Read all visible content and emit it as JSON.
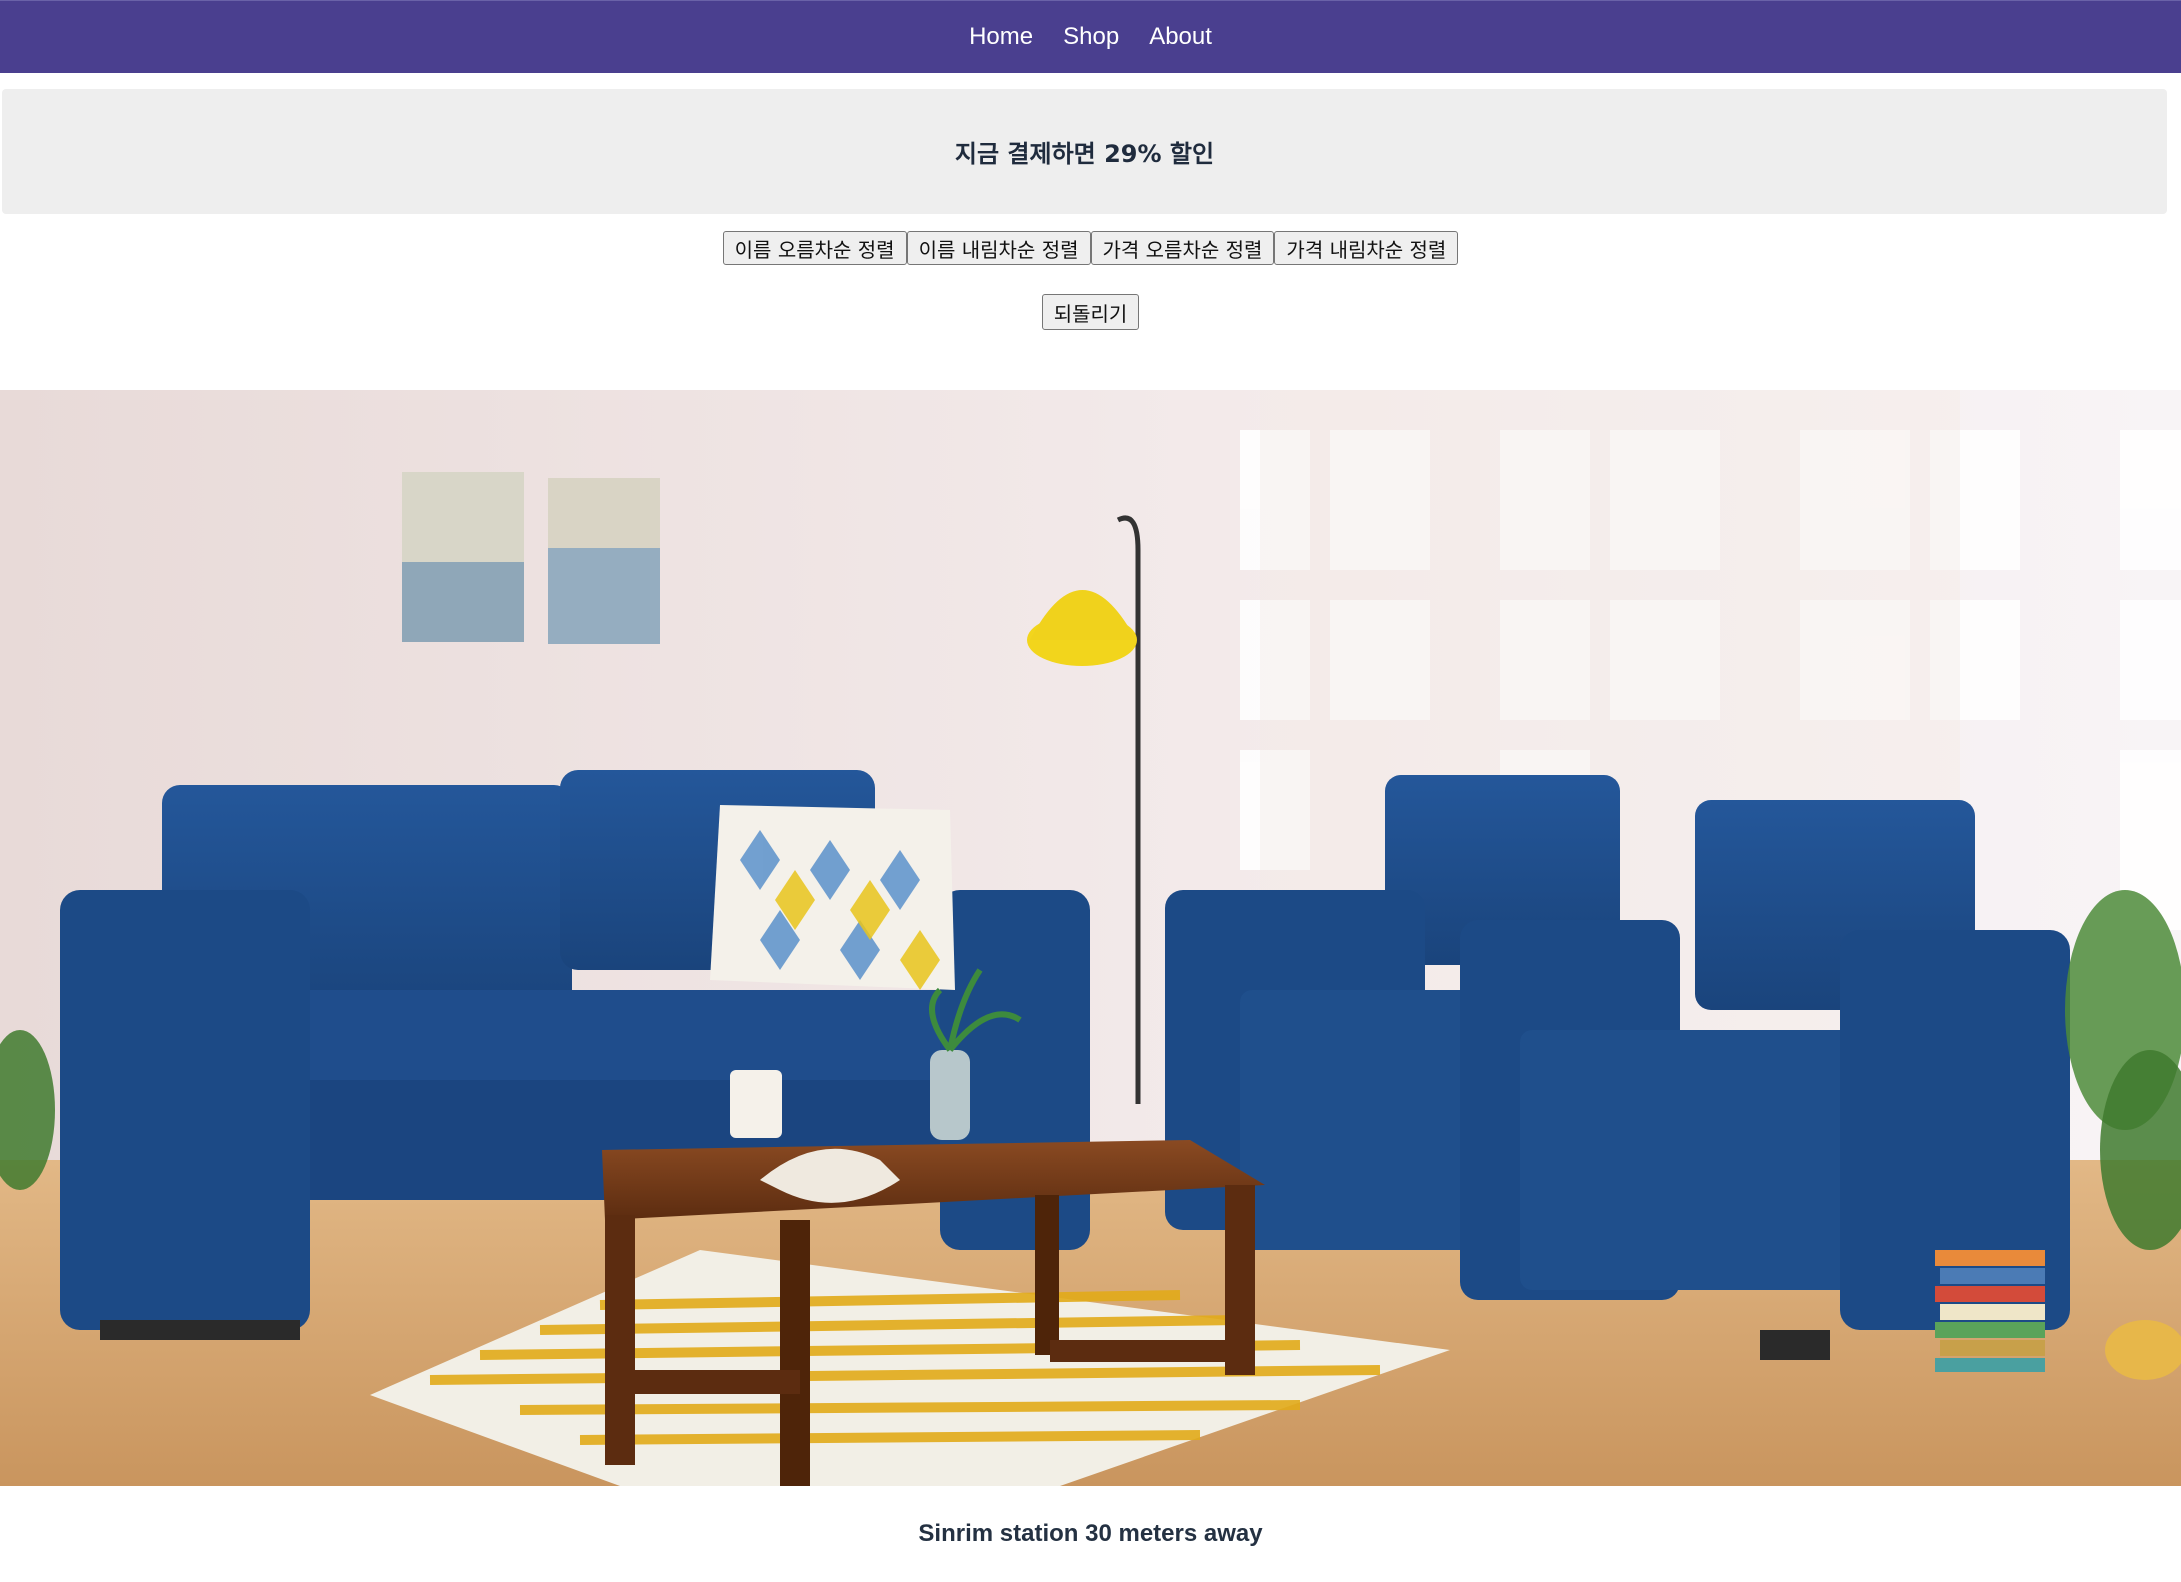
{
  "nav": {
    "items": [
      "Home",
      "Shop",
      "About"
    ]
  },
  "promo": {
    "text": "지금 결제하면 29% 할인"
  },
  "sort_buttons": {
    "name_asc": "이름 오름차순 정렬",
    "name_desc": "이름 내림차순 정렬",
    "price_asc": "가격 오름차순 정렬",
    "price_desc": "가격 내림차순 정렬"
  },
  "reset_button": "되돌리기",
  "caption": "Sinrim station 30 meters away",
  "colors": {
    "navbar": "#4a3f8f",
    "promo_bg": "#eeeeee",
    "sofa_blue": "#1f4f8c",
    "floor": "#d7a873"
  }
}
